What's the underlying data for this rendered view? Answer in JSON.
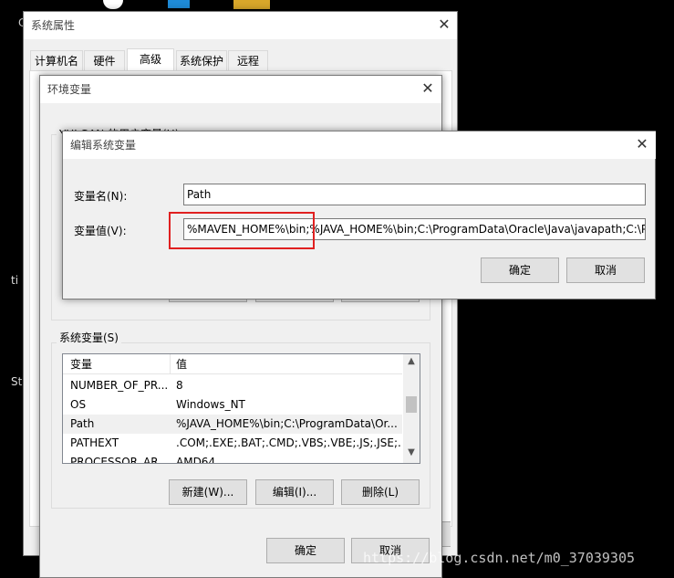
{
  "desktop": {
    "left_labels": [
      "C",
      "ti",
      "St"
    ]
  },
  "sys_props": {
    "title": "系统属性",
    "tabs": [
      {
        "label": "计算机名",
        "active": false
      },
      {
        "label": "硬件",
        "active": false
      },
      {
        "label": "高级",
        "active": true
      },
      {
        "label": "系统保护",
        "active": false
      },
      {
        "label": "远程",
        "active": false
      }
    ],
    "close_glyph": "✕"
  },
  "env_vars": {
    "title": "环境变量",
    "close_glyph": "✕",
    "user_group_label": "YULGAN 的用户变量(U)",
    "system_group_label": "系统变量(S)",
    "table_headers": {
      "name": "变量",
      "value": "值"
    },
    "rows": [
      {
        "name": "NUMBER_OF_PR...",
        "value": "8"
      },
      {
        "name": "OS",
        "value": "Windows_NT"
      },
      {
        "name": "Path",
        "value": "%JAVA_HOME%\\bin;C:\\ProgramData\\Or..."
      },
      {
        "name": "PATHEXT",
        "value": ".COM;.EXE;.BAT;.CMD;.VBS;.VBE;.JS;.JSE;...."
      },
      {
        "name": "PROCESSOR_AR...",
        "value": "AMD64"
      }
    ],
    "buttons": {
      "new": "新建(W)...",
      "edit": "编辑(I)...",
      "delete": "删除(L)"
    },
    "ok": "确定",
    "cancel": "取消"
  },
  "edit_var": {
    "title": "编辑系统变量",
    "close_glyph": "✕",
    "name_label": "变量名(N):",
    "name_value": "Path",
    "value_label": "变量值(V):",
    "value_value": "%MAVEN_HOME%\\bin;%JAVA_HOME%\\bin;C:\\ProgramData\\Oracle\\Java\\javapath;C:\\P",
    "ok": "确定",
    "cancel": "取消",
    "highlight_color": "#e02020"
  },
  "watermark": "https://blog.csdn.net/m0_37039305"
}
